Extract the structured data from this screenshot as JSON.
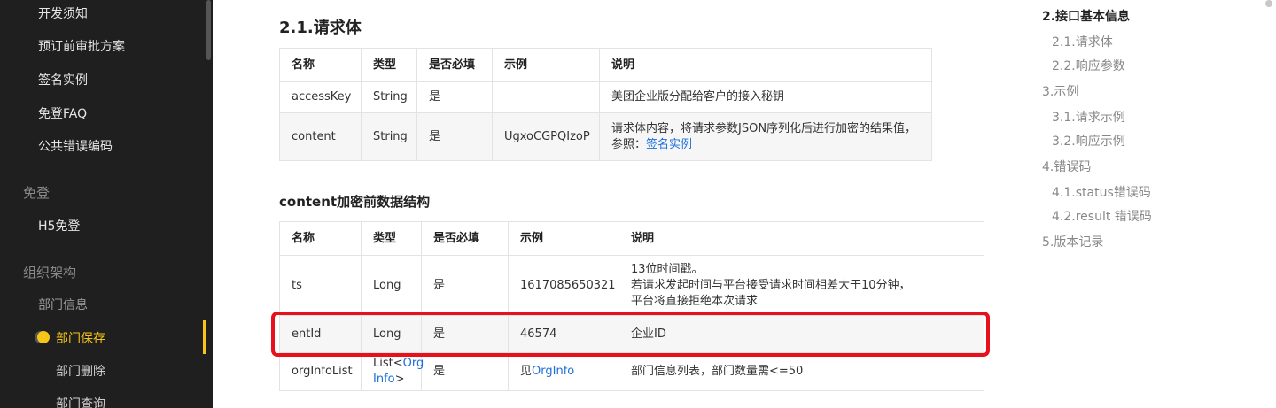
{
  "sidebar": {
    "items_top": [
      "开发须知",
      "预订前审批方案",
      "签名实例",
      "免登FAQ",
      "公共错误编码"
    ],
    "group_login": "免登",
    "h5_login": "H5免登",
    "group_org": "组织架构",
    "dept_info": "部门信息",
    "dept_save": "部门保存",
    "dept_delete": "部门删除",
    "dept_query": "部门查询"
  },
  "main": {
    "section_title": "2.1.请求体",
    "table1": {
      "headers": [
        "名称",
        "类型",
        "是否必填",
        "示例",
        "说明"
      ],
      "rows": [
        [
          "accessKey",
          "String",
          "是",
          "",
          "美团企业版分配给客户的接入秘钥"
        ],
        [
          "content",
          "String",
          "是",
          "UgxoCGPQIzoP",
          "请求体内容，将请求参数JSON序列化后进行加密的结果值，",
          "参照：",
          "签名实例"
        ]
      ]
    },
    "subsection_title": "content加密前数据结构",
    "table2": {
      "headers": [
        "名称",
        "类型",
        "是否必填",
        "示例",
        "说明"
      ],
      "rows": [
        [
          "ts",
          "Long",
          "是",
          "1617085650321",
          "13位时间戳。",
          "若请求发起时间与平台接受请求时间相差大于10分钟，",
          "平台将直接拒绝本次请求"
        ],
        [
          "entId",
          "Long",
          "是",
          "46574",
          "企业ID"
        ],
        [
          "orgInfoList",
          "List<",
          "Org",
          "Info",
          ">",
          "是",
          "见",
          "OrgInfo",
          "部门信息列表，部门数量需<=50"
        ]
      ]
    }
  },
  "toc": {
    "title": "2.接口基本信息",
    "items": [
      {
        "level": 2,
        "label": "2.1.请求体"
      },
      {
        "level": 2,
        "label": "2.2.响应参数"
      },
      {
        "level": 1,
        "label": "3.示例"
      },
      {
        "level": 2,
        "label": "3.1.请求示例"
      },
      {
        "level": 2,
        "label": "3.2.响应示例"
      },
      {
        "level": 1,
        "label": "4.错误码"
      },
      {
        "level": 2,
        "label": "4.1.status错误码"
      },
      {
        "level": 2,
        "label": "4.2.result 错误码"
      },
      {
        "level": 1,
        "label": "5.版本记录"
      }
    ]
  },
  "colors": {
    "sidebar_bg": "#1f1f1f",
    "active": "#f5c518",
    "link": "#1e6fd9",
    "highlight": "#e8101a"
  },
  "icons": [
    "active-dot-icon"
  ]
}
